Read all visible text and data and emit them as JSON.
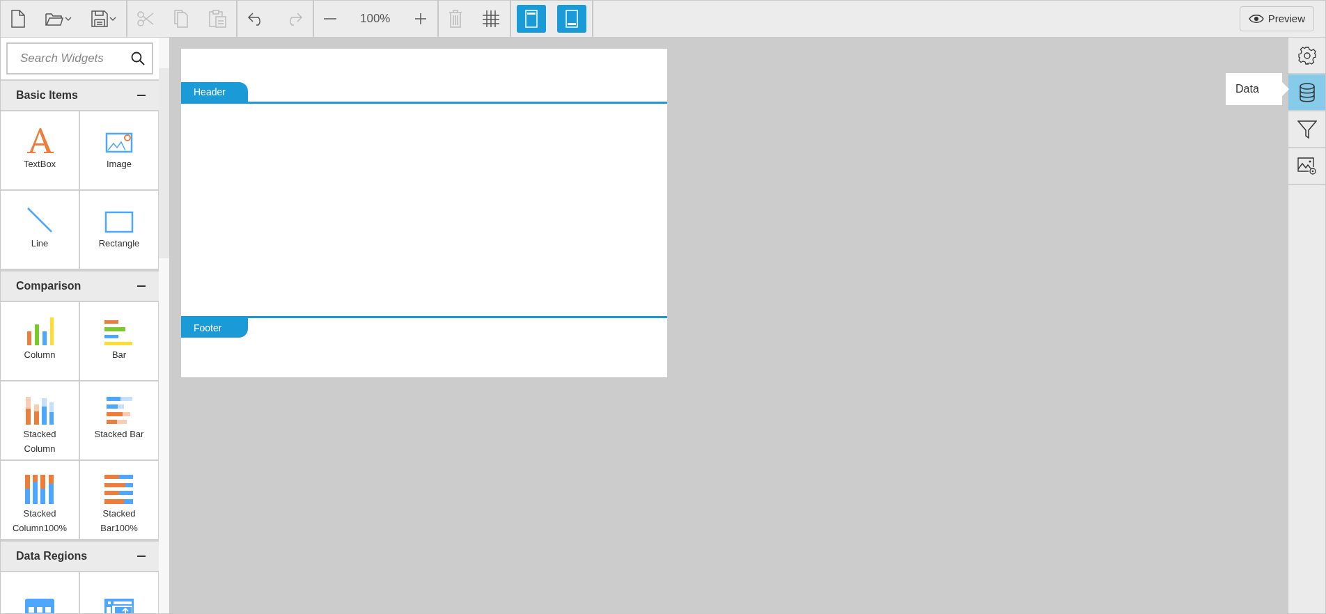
{
  "toolbar": {
    "groups": [
      [
        {
          "kind": "new",
          "disabled": false
        },
        {
          "kind": "open",
          "disabled": false
        },
        {
          "kind": "save",
          "disabled": false
        }
      ],
      [
        {
          "kind": "cut",
          "disabled": true
        },
        {
          "kind": "copy",
          "disabled": true
        },
        {
          "kind": "paste",
          "disabled": true
        }
      ],
      [
        {
          "kind": "undo",
          "disabled": false
        },
        {
          "kind": "redo",
          "disabled": true
        }
      ],
      [
        {
          "kind": "zoom-out",
          "disabled": false
        },
        {
          "kind": "zoom-level",
          "text": "100%"
        },
        {
          "kind": "zoom-in",
          "disabled": false
        }
      ],
      [
        {
          "kind": "delete",
          "disabled": true
        },
        {
          "kind": "grid",
          "disabled": false
        }
      ],
      [
        {
          "kind": "header-toggle",
          "selected": true
        },
        {
          "kind": "footer-toggle",
          "selected": true
        }
      ]
    ],
    "preview": {
      "label": "Preview"
    }
  },
  "sidebar": {
    "search": {
      "placeholder": "Search Widgets"
    },
    "categories": [
      {
        "title": "Basic Items",
        "expanded": true,
        "widgets": [
          {
            "kind": "textbox",
            "label": "TextBox"
          },
          {
            "kind": "image",
            "label": "Image"
          },
          {
            "kind": "line",
            "label": "Line"
          },
          {
            "kind": "rectangle",
            "label": "Rectangle"
          }
        ]
      },
      {
        "title": "Comparison",
        "expanded": true,
        "widgets": [
          {
            "kind": "column",
            "label": "Column"
          },
          {
            "kind": "bar",
            "label": "Bar"
          },
          {
            "kind": "stacked-column",
            "label": "Stacked Column"
          },
          {
            "kind": "stacked-bar",
            "label": "Stacked Bar"
          },
          {
            "kind": "stacked-column-100",
            "label": "Stacked Column100%"
          },
          {
            "kind": "stacked-bar-100",
            "label": "Stacked Bar100%"
          }
        ]
      },
      {
        "title": "Data Regions",
        "expanded": true,
        "widgets": [
          {
            "kind": "table"
          },
          {
            "kind": "matrix"
          }
        ]
      }
    ]
  },
  "report": {
    "bands": [
      {
        "kind": "header",
        "label": "Header"
      },
      {
        "kind": "footer",
        "label": "Footer"
      }
    ]
  },
  "right_panel": {
    "items": [
      {
        "kind": "properties",
        "selected": false
      },
      {
        "kind": "data",
        "selected": true,
        "tooltip": "Data"
      },
      {
        "kind": "filter",
        "selected": false
      },
      {
        "kind": "image-settings",
        "selected": false
      }
    ]
  }
}
